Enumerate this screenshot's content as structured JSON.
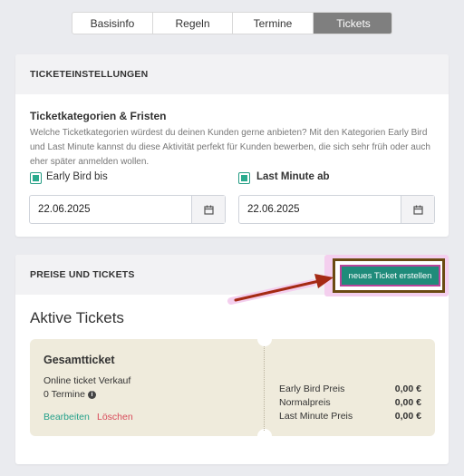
{
  "tabs": [
    "Basisinfo",
    "Regeln",
    "Termine",
    "Tickets"
  ],
  "active_tab": "Tickets",
  "ticket_settings": {
    "header": "TICKETEINSTELLUNGEN",
    "section_title": "Ticketkategorien & Fristen",
    "description": "Welche Ticketkategorien würdest du deinen Kunden gerne anbieten? Mit den Kategorien Early Bird und Last Minute kannst du diese Aktivität perfekt für Kunden bewerben, die sich sehr früh oder auch eher später anmelden wollen.",
    "early_bird": {
      "label": "Early Bird bis",
      "checked": true,
      "date": "22.06.2025"
    },
    "last_minute": {
      "label": "Last Minute ab",
      "checked": true,
      "date": "22.06.2025"
    },
    "calendar_icon": "calendar-icon"
  },
  "prices": {
    "header": "PREISE UND TICKETS",
    "new_ticket_button": "neues Ticket erstellen",
    "active_title": "Aktive Tickets",
    "ticket": {
      "name": "Gesamtticket",
      "channel": "Online ticket Verkauf",
      "termine": "0 Termine",
      "info_icon": "info-icon",
      "edit": "Bearbeiten",
      "delete": "Löschen",
      "price_rows": [
        {
          "label": "Early Bird Preis",
          "value": "0,00 €"
        },
        {
          "label": "Normalpreis",
          "value": "0,00 €"
        },
        {
          "label": "Last Minute Preis",
          "value": "0,00 €"
        }
      ]
    }
  },
  "colors": {
    "accent": "#2aab8e",
    "active_tab": "#7f7f7f",
    "delete": "#d84a5a",
    "ticket_bg": "#efebdc",
    "annotation": "#a52a14"
  }
}
